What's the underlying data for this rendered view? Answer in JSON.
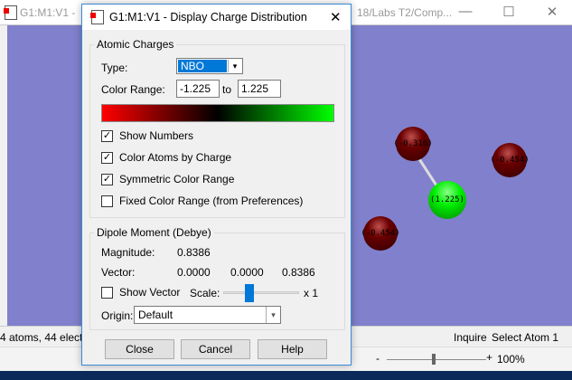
{
  "main_window": {
    "title_left": "G1:M1:V1 - ",
    "title_right": "18/Labs T2/Comp...",
    "minimize": "—",
    "maximize": "☐",
    "close": "✕"
  },
  "atoms": [
    {
      "label": "(-0.316)"
    },
    {
      "label": "(-0.454)"
    },
    {
      "label": "(1.225)"
    },
    {
      "label": "(-0.454)"
    }
  ],
  "colors": {
    "background": "#8080cc",
    "negative": "#6a0000",
    "positive": "#00ee00",
    "accent": "#0078d7"
  },
  "status_bar": {
    "info": "4 atoms, 44 elect",
    "mode": "Inquire",
    "action": "Select Atom 1"
  },
  "word_bar": {
    "zoom": "100%",
    "minus": "-",
    "plus": "+"
  },
  "dialog": {
    "title": "G1:M1:V1 - Display Charge Distribution",
    "close": "✕",
    "atomic_charges": {
      "legend": "Atomic Charges",
      "type_label": "Type:",
      "type_value": "NBO",
      "color_range_label": "Color Range:",
      "range_min": "-1.225",
      "to_label": "to",
      "range_max": "1.225",
      "checkboxes": [
        {
          "label": "Show Numbers",
          "checked": true
        },
        {
          "label": "Color Atoms by Charge",
          "checked": true
        },
        {
          "label": "Symmetric Color Range",
          "checked": true
        },
        {
          "label": "Fixed Color Range (from Preferences)",
          "checked": false
        }
      ]
    },
    "dipole": {
      "legend": "Dipole Moment (Debye)",
      "magnitude_label": "Magnitude:",
      "magnitude": "0.8386",
      "vector_label": "Vector:",
      "vx": "0.0000",
      "vy": "0.0000",
      "vz": "0.8386",
      "show_vector_label": "Show Vector",
      "show_vector_checked": false,
      "scale_label": "Scale:",
      "scale_value": "x 1",
      "scale_fraction": 0.35,
      "origin_label": "Origin:",
      "origin_value": "Default"
    },
    "buttons": {
      "close": "Close",
      "cancel": "Cancel",
      "help": "Help"
    }
  }
}
